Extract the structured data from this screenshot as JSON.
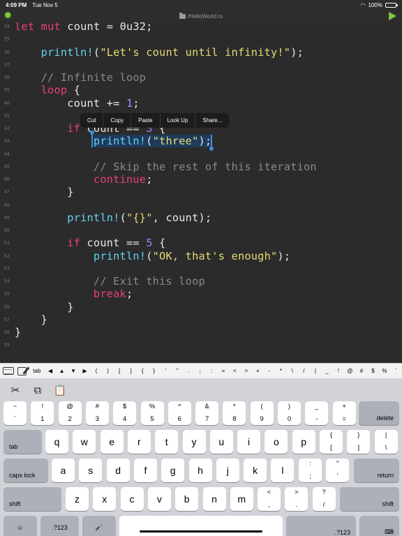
{
  "status": {
    "time": "4:09 PM",
    "date": "Tue Nov 5",
    "battery": "100%"
  },
  "title": {
    "file": "/HelloWorld.rs"
  },
  "icons": {
    "settings": "gear-icon",
    "run": "play-icon",
    "folder": "folder-icon",
    "wifi": "wifi-icon",
    "battery": "battery-icon"
  },
  "colors": {
    "accent": "#7ecb3a",
    "keyword": "#e8407a",
    "string": "#e6db74",
    "comment": "#8a8a8a",
    "macro": "#66d1ef",
    "number": "#ae81ff",
    "selection": "#1e3b5a"
  },
  "editor": {
    "lines": [
      {
        "n": "34",
        "html": "<span class='kw'>let</span> <span class='kw'>mut</span> count = 0u32;"
      },
      {
        "n": "35",
        "html": ""
      },
      {
        "n": "36",
        "html": "    <span class='mac'>println!</span>(<span class='str'>\"Let's count until infinity!\"</span>);"
      },
      {
        "n": "37",
        "html": ""
      },
      {
        "n": "38",
        "html": "    <span class='cmt'>// Infinite loop</span>"
      },
      {
        "n": "39",
        "html": "    <span class='kw'>loop</span> {"
      },
      {
        "n": "40",
        "html": "        count += <span class='num'>1</span>;"
      },
      {
        "n": "41",
        "html": ""
      },
      {
        "n": "42",
        "html": "        <span class='kw'>if</span> count == <span class='num'>3</span> {"
      },
      {
        "n": "43",
        "html": "            <span class='sel'><span class='mac'>println!</span>(<span class='str'>\"three\"</span>);</span>"
      },
      {
        "n": "44",
        "html": ""
      },
      {
        "n": "45",
        "html": "            <span class='cmt'>// Skip the rest of this iteration</span>"
      },
      {
        "n": "46",
        "html": "            <span class='kw'>continue</span>;"
      },
      {
        "n": "47",
        "html": "        }"
      },
      {
        "n": "48",
        "html": ""
      },
      {
        "n": "49",
        "html": "        <span class='mac'>println!</span>(<span class='str'>\"{}\"</span>, count);"
      },
      {
        "n": "50",
        "html": ""
      },
      {
        "n": "51",
        "html": "        <span class='kw'>if</span> count == <span class='num'>5</span> {"
      },
      {
        "n": "52",
        "html": "            <span class='mac'>println!</span>(<span class='str'>\"OK, that's enough\"</span>);"
      },
      {
        "n": "53",
        "html": ""
      },
      {
        "n": "54",
        "html": "            <span class='cmt'>// Exit this loop</span>"
      },
      {
        "n": "55",
        "html": "            <span class='kw'>break</span>;"
      },
      {
        "n": "56",
        "html": "        }"
      },
      {
        "n": "57",
        "html": "    }"
      },
      {
        "n": "58",
        "html": "}"
      },
      {
        "n": "59",
        "html": ""
      }
    ],
    "context_menu": [
      "Cut",
      "Copy",
      "Paste",
      "Look Up",
      "Share..."
    ]
  },
  "accessory": {
    "tab_label": "tab",
    "symbols": [
      "◀",
      "▲",
      "▼",
      "▶",
      "(",
      ")",
      "[",
      "]",
      "{",
      "}",
      "'",
      "\"",
      ".",
      ";",
      ":",
      "=",
      "<",
      ">",
      "+",
      "-",
      "*",
      "\\",
      "/",
      "|",
      "_",
      "!",
      "@",
      "#",
      "$",
      "%",
      "`"
    ]
  },
  "keyboard": {
    "shortcuts": [
      "✂",
      "⧉",
      "📋"
    ],
    "row1": [
      [
        "~",
        "`"
      ],
      [
        "!",
        "1"
      ],
      [
        "@",
        "2"
      ],
      [
        "#",
        "3"
      ],
      [
        "$",
        "4"
      ],
      [
        "%",
        "5"
      ],
      [
        "^",
        "6"
      ],
      [
        "&",
        "7"
      ],
      [
        "*",
        "8"
      ],
      [
        "(",
        "9"
      ],
      [
        ")",
        "0"
      ],
      [
        "_",
        "-"
      ],
      [
        "+",
        "="
      ]
    ],
    "delete": "delete",
    "tab": "tab",
    "row2": [
      "q",
      "w",
      "e",
      "r",
      "t",
      "y",
      "u",
      "i",
      "o",
      "p"
    ],
    "row2_extra": [
      [
        "{",
        "["
      ],
      [
        "}",
        "]"
      ],
      [
        "|",
        "\\"
      ]
    ],
    "caps": "caps lock",
    "row3": [
      "a",
      "s",
      "d",
      "f",
      "g",
      "h",
      "j",
      "k",
      "l"
    ],
    "row3_extra": [
      [
        ":",
        ";"
      ],
      [
        "\"",
        "'"
      ]
    ],
    "return": "return",
    "shift": "shift",
    "row4": [
      "z",
      "x",
      "c",
      "v",
      "b",
      "n",
      "m"
    ],
    "row4_extra": [
      [
        "<",
        ","
      ],
      [
        ">",
        "."
      ],
      [
        "?",
        "/"
      ]
    ],
    "numbers": ".?123",
    "emoji": "☺",
    "mic": "🎤",
    "hide": "⌨"
  }
}
